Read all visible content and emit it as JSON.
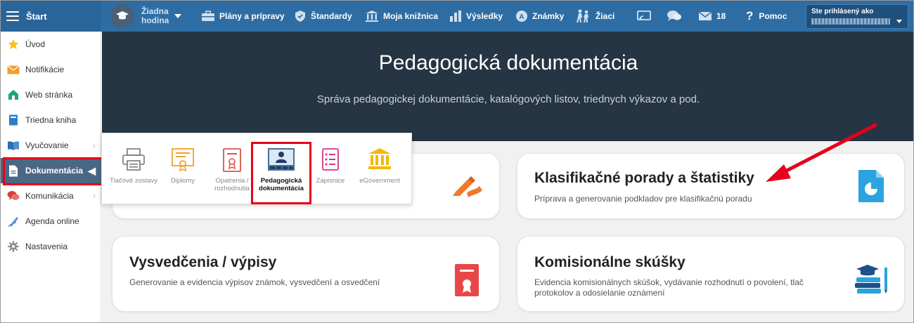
{
  "topbar": {
    "brand": "Štart",
    "lesson": [
      "Žiadna",
      "hodina"
    ],
    "nav": [
      {
        "label": "Plány a prípravy",
        "icon": "briefcase-icon"
      },
      {
        "label": "Štandardy",
        "icon": "shield-icon"
      },
      {
        "label": "Moja knižnica",
        "icon": "library-icon"
      },
      {
        "label": "Výsledky",
        "icon": "bar-chart-icon"
      },
      {
        "label": "Známky",
        "icon": "grades-icon"
      },
      {
        "label": "Žiaci",
        "icon": "students-icon"
      }
    ],
    "mail_count": "18",
    "help": "Pomoc",
    "user_label": "Ste prihlásený ako"
  },
  "sidebar": {
    "items": [
      {
        "label": "Úvod",
        "icon": "star-icon",
        "chevron": false
      },
      {
        "label": "Notifikácie",
        "icon": "envelope-icon",
        "chevron": false
      },
      {
        "label": "Web stránka",
        "icon": "home-icon",
        "chevron": false
      },
      {
        "label": "Triedna kniha",
        "icon": "book-icon",
        "chevron": false
      },
      {
        "label": "Vyučovanie",
        "icon": "open-book-icon",
        "chevron": true
      },
      {
        "label": "Dokumentácia",
        "icon": "document-icon",
        "chevron": true,
        "active": true
      },
      {
        "label": "Komunikácia",
        "icon": "chat-icon",
        "chevron": true
      },
      {
        "label": "Agenda online",
        "icon": "pen-icon",
        "chevron": false
      },
      {
        "label": "Nastavenia",
        "icon": "gear-icon",
        "chevron": false
      }
    ]
  },
  "hero": {
    "title": "Pedagogická dokumentácia",
    "subtitle": "Správa pedagogickej dokumentácie, katalógových listov, triednych výkazov a pod."
  },
  "popup": {
    "items": [
      {
        "label": "Tlačové zostavy",
        "icon": "printer-icon"
      },
      {
        "label": "Diplomy",
        "icon": "diploma-icon"
      },
      {
        "label": "Opatrenia / rozhodnutia",
        "icon": "decision-icon"
      },
      {
        "label": "Pedagogická dokumentácia",
        "icon": "class-icon",
        "selected": true
      },
      {
        "label": "Zápisnice",
        "icon": "list-icon"
      },
      {
        "label": "eGovernment",
        "icon": "government-icon"
      }
    ]
  },
  "cards": [
    {
      "title": "Klasifikačné porady a štatistiky",
      "desc": "Príprava a generovanie podkladov pre klasifikačnú poradu",
      "icon": "pie-file-icon"
    },
    {
      "title": "Vysvedčenia / výpisy",
      "desc": "Generovanie a evidencia výpisov známok, vysvedčení a osvedčení",
      "icon": "certificate-icon"
    },
    {
      "title": "Komisionálne skúšky",
      "desc": "Evidencia komisionálnych skúšok, vydávanie rozhodnutí o povolení, tlač protokolov a odosielanie oznámení",
      "icon": "graduation-books-icon"
    }
  ],
  "colors": {
    "accent": "#2e6da4",
    "hero": "#263544",
    "highlight": "#e5001b",
    "orange": "#f0792b"
  }
}
